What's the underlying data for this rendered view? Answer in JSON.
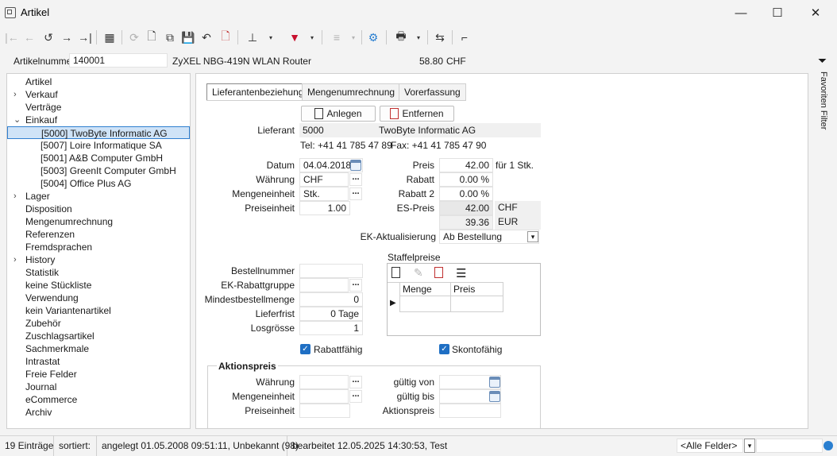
{
  "window": {
    "title": "Artikel",
    "minimize": "—",
    "maximize": "☐",
    "close": "✕"
  },
  "toolbar": {
    "first": "|←",
    "back": "←",
    "history": "↺",
    "forward": "→",
    "last": "→|",
    "table": "▦",
    "refresh": "⟳",
    "new": "🗋",
    "copy": "⧉",
    "save": "💾",
    "undo": "↶",
    "delete": "🗋",
    "pin": "⊥",
    "filter": "▼",
    "sort": "≡",
    "settings": "⚙",
    "print": "🖶",
    "link": "⇆",
    "book": "⌐"
  },
  "header": {
    "artnr_label": "Artikelnummer",
    "artnr_value": "140001",
    "description": "ZyXEL NBG-419N WLAN Router",
    "price": "58.80",
    "currency": "CHF"
  },
  "sidebar": {
    "items": [
      {
        "label": "Artikel",
        "chev": ""
      },
      {
        "label": "Verkauf",
        "chev": "›"
      },
      {
        "label": "Verträge",
        "chev": ""
      },
      {
        "label": "Einkauf",
        "chev": "⌄"
      },
      {
        "label": "[5000]  TwoByte Informatic AG",
        "chev": ""
      },
      {
        "label": "[5007]  Loire Informatique SA",
        "chev": ""
      },
      {
        "label": "[5001]  A&B Computer GmbH",
        "chev": ""
      },
      {
        "label": "[5003]  GreenIt Computer GmbH",
        "chev": ""
      },
      {
        "label": "[5004]  Office Plus AG",
        "chev": ""
      },
      {
        "label": "Lager",
        "chev": "›"
      },
      {
        "label": "Disposition",
        "chev": ""
      },
      {
        "label": "Mengenumrechnung",
        "chev": ""
      },
      {
        "label": "Referenzen",
        "chev": ""
      },
      {
        "label": "Fremdsprachen",
        "chev": ""
      },
      {
        "label": "History",
        "chev": "›"
      },
      {
        "label": "Statistik",
        "chev": ""
      },
      {
        "label": "keine Stückliste",
        "chev": ""
      },
      {
        "label": "Verwendung",
        "chev": ""
      },
      {
        "label": "kein Variantenartikel",
        "chev": ""
      },
      {
        "label": "Zubehör",
        "chev": ""
      },
      {
        "label": "Zuschlagsartikel",
        "chev": ""
      },
      {
        "label": "Sachmerkmale",
        "chev": ""
      },
      {
        "label": "Intrastat",
        "chev": ""
      },
      {
        "label": "Freie Felder",
        "chev": ""
      },
      {
        "label": "Journal",
        "chev": ""
      },
      {
        "label": "eCommerce",
        "chev": ""
      },
      {
        "label": "Archiv",
        "chev": ""
      }
    ]
  },
  "tabs": [
    "Lieferantenbeziehung",
    "Mengenumrechnung",
    "Vorerfassung"
  ],
  "buttons": {
    "create": "Anlegen",
    "remove": "Entfernen"
  },
  "supplier": {
    "label": "Lieferant",
    "number": "5000",
    "name": "TwoByte Informatic AG",
    "phone": "Tel: +41 41 785 47 89",
    "fax": "Fax: +41 41 785 47 90"
  },
  "form": {
    "datum_label": "Datum",
    "datum": "04.04.2018",
    "waehrung_label": "Währung",
    "waehrung": "CHF",
    "mengeneinheit_label": "Mengeneinheit",
    "mengeneinheit": "Stk.",
    "preiseinheit_label": "Preiseinheit",
    "preiseinheit": "1.00",
    "preis_label": "Preis",
    "preis": "42.00",
    "preis_suffix": "für 1 Stk.",
    "rabatt_label": "Rabatt",
    "rabatt": "0.00 %",
    "rabatt2_label": "Rabatt 2",
    "rabatt2": "0.00 %",
    "espreis_label": "ES-Preis",
    "espreis_chf": "42.00",
    "espreis_chf_cur": "CHF",
    "espreis_eur": "39.36",
    "espreis_eur_cur": "EUR",
    "ek_label": "EK-Aktualisierung",
    "ek_value": "Ab Bestellung",
    "ek_arrow": "▾",
    "bestellnr_label": "Bestellnummer",
    "bestellnr": "",
    "ekrabatt_label": "EK-Rabattgruppe",
    "ekrabatt": "",
    "mindest_label": "Mindestbestellmenge",
    "mindest": "0",
    "lieferfrist_label": "Lieferfrist",
    "lieferfrist": "0 Tage",
    "losgroesse_label": "Losgrösse",
    "losgroesse": "1",
    "rabattfaehig_label": "Rabattfähig",
    "skontofaehig_label": "Skontofähig",
    "check": "✓",
    "dots": "..."
  },
  "staffel": {
    "title": "Staffelpreise",
    "col_menge": "Menge",
    "col_preis": "Preis",
    "row_marker": "▶"
  },
  "aktion": {
    "title": "Aktionspreis",
    "waehrung_label": "Währung",
    "mengeneinheit_label": "Mengeneinheit",
    "preiseinheit_label": "Preiseinheit",
    "von_label": "gültig von",
    "bis_label": "gültig bis",
    "preis_label": "Aktionspreis"
  },
  "side": {
    "filter_icon": "⏷",
    "label": "Favoriten Filter"
  },
  "status": {
    "count": "19 Einträge",
    "sorted": "sortiert:",
    "created": "angelegt 01.05.2008 09:51:11, Unbekannt (98)",
    "edited": "bearbeitet 12.05.2025 14:30:53, Test",
    "fields": "<Alle Felder>",
    "arrow": "▾"
  }
}
